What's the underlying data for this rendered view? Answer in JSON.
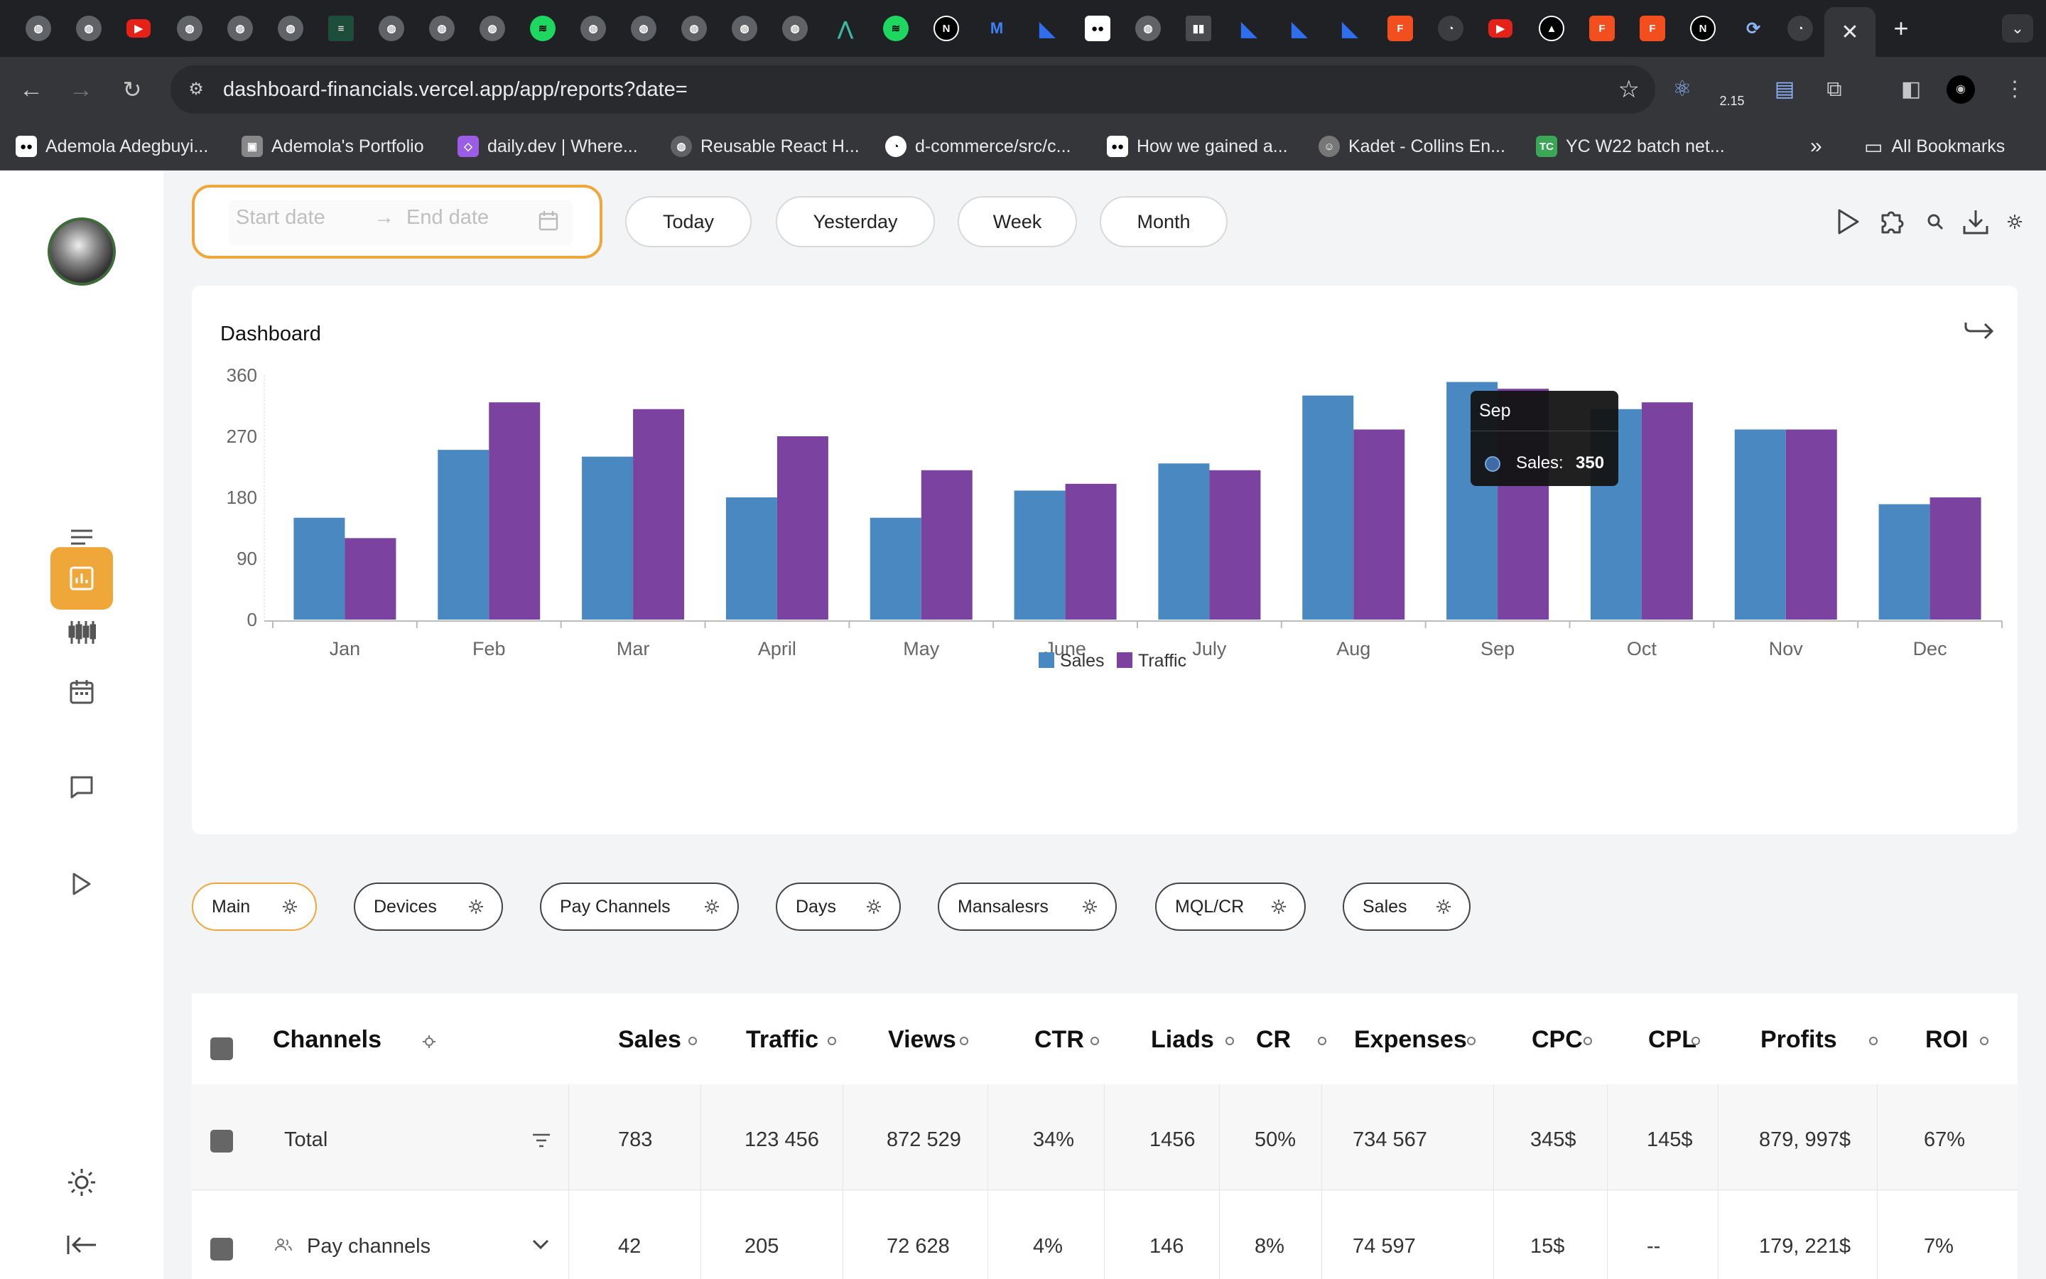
{
  "browser": {
    "active_tab_close": "✕",
    "new_tab": "+",
    "url": "dashboard-financials.vercel.app/app/reports?date=",
    "ext_badge": "2.15",
    "bookmarks": [
      {
        "label": "Ademola Adegbuyi..."
      },
      {
        "label": "Ademola's Portfolio"
      },
      {
        "label": "daily.dev | Where..."
      },
      {
        "label": "Reusable React H..."
      },
      {
        "label": "d-commerce/src/c..."
      },
      {
        "label": "How we gained a..."
      },
      {
        "label": "Kadet - Collins En..."
      },
      {
        "label": "YC W22 batch net..."
      }
    ],
    "bookmarks_overflow": "»",
    "all_bookmarks": "All Bookmarks"
  },
  "toolbar": {
    "start_placeholder": "Start date",
    "end_placeholder": "End date",
    "arrow": "→",
    "filters": [
      "Today",
      "Yesterday",
      "Week",
      "Month"
    ]
  },
  "dashboard": {
    "title": "Dashboard",
    "tooltip": {
      "month": "Sep",
      "label": "Sales:",
      "value": "350"
    }
  },
  "chart_data": {
    "type": "bar",
    "title": "",
    "categories": [
      "Jan",
      "Feb",
      "Mar",
      "April",
      "May",
      "June",
      "July",
      "Aug",
      "Sep",
      "Oct",
      "Nov",
      "Dec"
    ],
    "series": [
      {
        "name": "Sales",
        "color": "#4a88c2",
        "values": [
          150,
          250,
          240,
          180,
          150,
          190,
          230,
          330,
          350,
          310,
          280,
          170
        ]
      },
      {
        "name": "Traffic",
        "color": "#7b42a0",
        "values": [
          120,
          320,
          310,
          270,
          220,
          200,
          220,
          280,
          340,
          320,
          280,
          180
        ]
      }
    ],
    "ylim": [
      0,
      360
    ],
    "yticks": [
      0,
      90,
      180,
      270,
      360
    ],
    "grid": false,
    "legend": "bottom-center"
  },
  "report_tabs": [
    "Main",
    "Devices",
    "Pay Channels",
    "Days",
    "Mansalesrs",
    "MQL/CR",
    "Sales"
  ],
  "table": {
    "columns": [
      "Channels",
      "Sales",
      "Traffic",
      "Views",
      "CTR",
      "Liads",
      "CR",
      "Expenses",
      "CPC",
      "CPL",
      "Profits",
      "ROI"
    ],
    "rows": [
      {
        "channel": "Total",
        "cells": [
          "783",
          "123 456",
          "872 529",
          "34%",
          "1456",
          "50%",
          "734 567",
          "345$",
          "145$",
          "879, 997$",
          "67%"
        ]
      },
      {
        "channel": "Pay channels",
        "cells": [
          "42",
          "205",
          "72 628",
          "4%",
          "146",
          "8%",
          "74 597",
          "15$",
          "--",
          "179, 221$",
          "7%"
        ]
      }
    ]
  },
  "colors": {
    "accent": "#f0a73a",
    "sales": "#4a88c2",
    "traffic": "#7b42a0"
  }
}
